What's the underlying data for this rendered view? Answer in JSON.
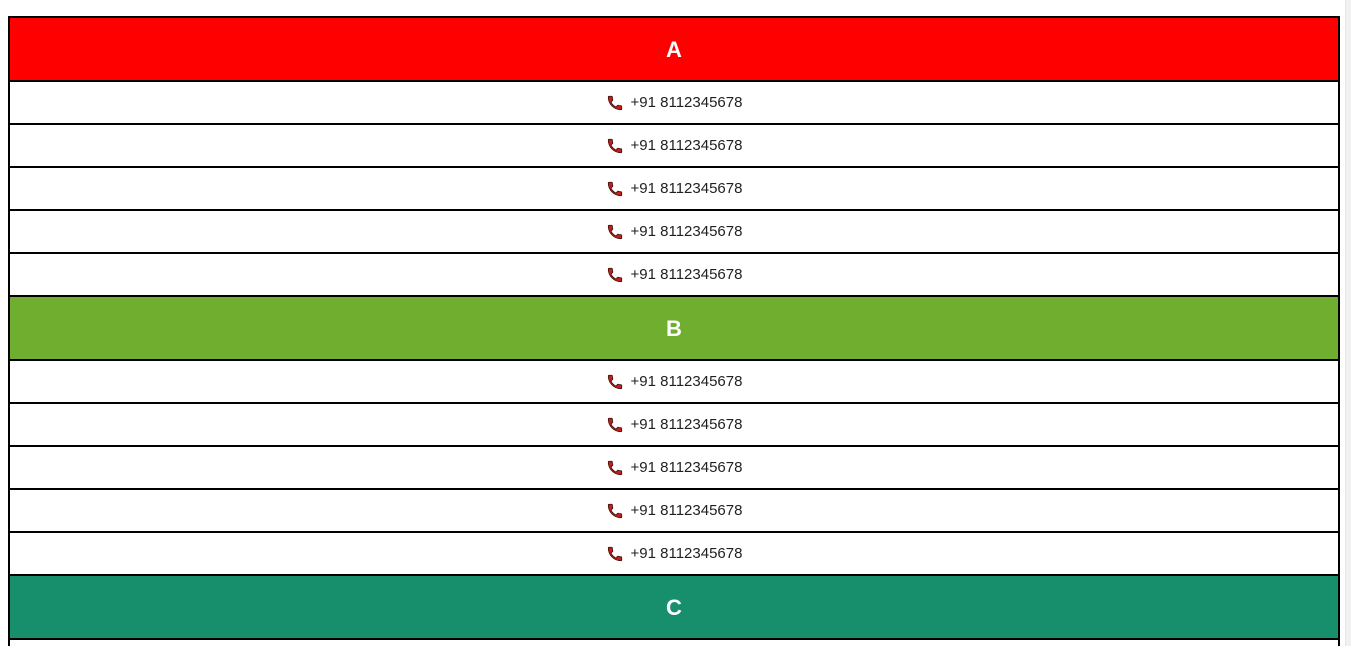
{
  "groups": [
    {
      "label": "A",
      "color": "#ff0000",
      "rows": [
        "+91 8112345678",
        "+91 8112345678",
        "+91 8112345678",
        "+91 8112345678",
        "+91 8112345678"
      ]
    },
    {
      "label": "B",
      "color": "#6fae2e",
      "rows": [
        "+91 8112345678",
        "+91 8112345678",
        "+91 8112345678",
        "+91 8112345678",
        "+91 8112345678"
      ]
    },
    {
      "label": "C",
      "color": "#188f6c",
      "rows": []
    }
  ],
  "icons": {
    "row_icon": "phone-icon",
    "phone_icon_color": "#c0201b"
  }
}
